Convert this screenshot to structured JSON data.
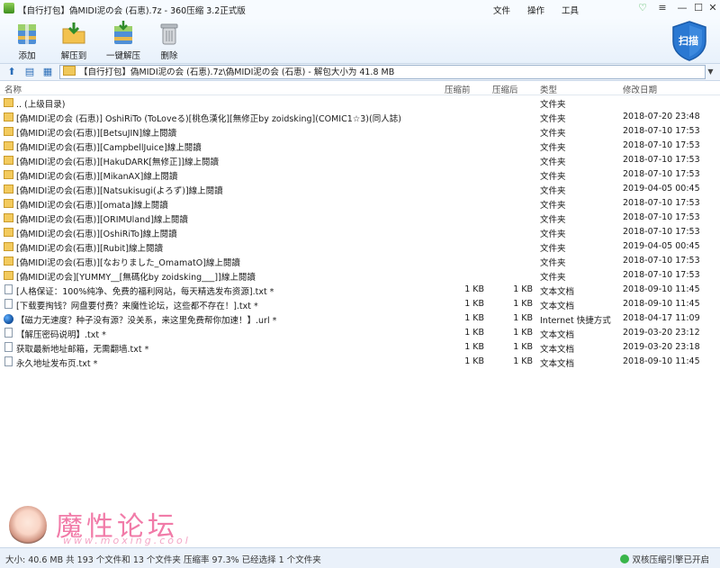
{
  "window": {
    "title": "【自行打包】偽MIDI泥の会 (石恵).7z - 360压缩 3.2正式版",
    "menu": [
      "文件",
      "操作",
      "工具"
    ],
    "controls": {
      "help": "♡",
      "menu": "≡",
      "minimize": "—",
      "maximize": "☐",
      "close": "✕"
    }
  },
  "toolbar": {
    "add": "添加",
    "extract_to": "解压到",
    "one_click_extract": "一键解压",
    "delete": "删除",
    "scan": "扫描"
  },
  "address": {
    "path": "【自行打包】偽MIDI泥の会 (石恵).7z\\偽MIDI泥の会 (石恵) - 解包大小为 41.8 MB"
  },
  "columns": {
    "name": "名称",
    "packed": "压缩前",
    "size": "压缩后",
    "type": "类型",
    "date": "修改日期"
  },
  "files": [
    {
      "icon": "folder",
      "name": ".. (上级目录)",
      "packed": "",
      "size": "",
      "type": "文件夹",
      "date": ""
    },
    {
      "icon": "folder",
      "name": "[偽MIDI泥の会 (石恵)] OshiRiTo (ToLoveる)[桃色漢化][無修正by zoidsking](COMIC1☆3)(同人誌)",
      "packed": "",
      "size": "",
      "type": "文件夹",
      "date": "2018-07-20 23:48"
    },
    {
      "icon": "folder",
      "name": "[偽MIDI泥の会(石恵)][BetsuJIN]線上閱讀",
      "packed": "",
      "size": "",
      "type": "文件夹",
      "date": "2018-07-10 17:53"
    },
    {
      "icon": "folder",
      "name": "[偽MIDI泥の会(石恵)][CampbellJuice]線上閱讀",
      "packed": "",
      "size": "",
      "type": "文件夹",
      "date": "2018-07-10 17:53"
    },
    {
      "icon": "folder",
      "name": "[偽MIDI泥の会(石恵)][HakuDARK[無修正]]線上閱讀",
      "packed": "",
      "size": "",
      "type": "文件夹",
      "date": "2018-07-10 17:53"
    },
    {
      "icon": "folder",
      "name": "[偽MIDI泥の会(石恵)][MikanAX]線上閱讀",
      "packed": "",
      "size": "",
      "type": "文件夹",
      "date": "2018-07-10 17:53"
    },
    {
      "icon": "folder",
      "name": "[偽MIDI泥の会(石恵)][Natsukisugi(よろず)]線上閱讀",
      "packed": "",
      "size": "",
      "type": "文件夹",
      "date": "2019-04-05 00:45"
    },
    {
      "icon": "folder",
      "name": "[偽MIDI泥の会(石恵)][omata]線上閱讀",
      "packed": "",
      "size": "",
      "type": "文件夹",
      "date": "2018-07-10 17:53"
    },
    {
      "icon": "folder",
      "name": "[偽MIDI泥の会(石恵)][ORIMUland]線上閱讀",
      "packed": "",
      "size": "",
      "type": "文件夹",
      "date": "2018-07-10 17:53"
    },
    {
      "icon": "folder",
      "name": "[偽MIDI泥の会(石恵)][OshiRiTo]線上閱讀",
      "packed": "",
      "size": "",
      "type": "文件夹",
      "date": "2018-07-10 17:53"
    },
    {
      "icon": "folder",
      "name": "[偽MIDI泥の会(石恵)][Rubit]線上閱讀",
      "packed": "",
      "size": "",
      "type": "文件夹",
      "date": "2019-04-05 00:45"
    },
    {
      "icon": "folder",
      "name": "[偽MIDI泥の会(石恵)][なおりました_OmamatO]線上閱讀",
      "packed": "",
      "size": "",
      "type": "文件夹",
      "date": "2018-07-10 17:53"
    },
    {
      "icon": "folder",
      "name": "[偽MIDI泥の会][YUMMY__[無碼化by zoidsking___]]線上閱讀",
      "packed": "",
      "size": "",
      "type": "文件夹",
      "date": "2018-07-10 17:53"
    },
    {
      "icon": "doc",
      "name": "[人格保证：100%纯净、免费的福利网站，每天精选发布资源].txt *",
      "packed": "1 KB",
      "size": "1 KB",
      "type": "文本文档",
      "date": "2018-09-10 11:45"
    },
    {
      "icon": "doc",
      "name": "[下载要掏钱？网盘要付费？来魔性论坛，这些都不存在！].txt *",
      "packed": "1 KB",
      "size": "1 KB",
      "type": "文本文档",
      "date": "2018-09-10 11:45"
    },
    {
      "icon": "globe",
      "name": "【磁力无速度？种子没有源？没关系，来这里免费帮你加速！】.url *",
      "packed": "1 KB",
      "size": "1 KB",
      "type": "Internet 快捷方式",
      "date": "2018-04-17 11:09"
    },
    {
      "icon": "doc",
      "name": "【解压密码说明】.txt *",
      "packed": "1 KB",
      "size": "1 KB",
      "type": "文本文档",
      "date": "2019-03-20 23:12"
    },
    {
      "icon": "doc",
      "name": "获取最新地址邮箱，无需翻墙.txt *",
      "packed": "1 KB",
      "size": "1 KB",
      "type": "文本文档",
      "date": "2019-03-20 23:18"
    },
    {
      "icon": "doc",
      "name": "永久地址发布页.txt *",
      "packed": "1 KB",
      "size": "1 KB",
      "type": "文本文档",
      "date": "2018-09-10 11:45"
    }
  ],
  "watermark": {
    "title": "魔性论坛",
    "url": "www.moxing.cool"
  },
  "status": {
    "text": "大小: 40.6 MB 共 193 个文件和 13 个文件夹 压缩率 97.3% 已经选择 1 个文件夹",
    "right": "双核压缩引擎已开启"
  },
  "colors": {
    "accent": "#2a6db8",
    "folder": "#f3ca5d",
    "watermark": "#f17ba8"
  }
}
